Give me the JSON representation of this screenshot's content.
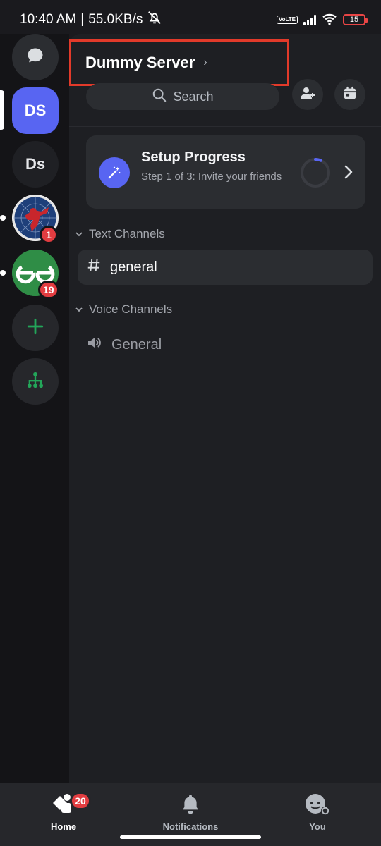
{
  "status_bar": {
    "time": "10:40 AM",
    "speed": "55.0KB/s",
    "network_badge": "VoLTE",
    "battery": "15"
  },
  "server_rail": {
    "direct_messages_icon": "chat-bubble-icon",
    "servers": [
      {
        "label": "DS",
        "selected": true
      },
      {
        "label": "Ds"
      },
      {
        "icon": "spiderman-server-image",
        "badge": "1"
      },
      {
        "icon": "geeksforgeeks-server-image",
        "badge": "19"
      }
    ],
    "add_server_icon": "plus-icon",
    "discover_icon": "hierarchy-icon"
  },
  "server": {
    "name": "Dummy Server",
    "chevron": "›",
    "search_label": "Search"
  },
  "setup": {
    "title": "Setup Progress",
    "subtitle": "Step 1 of 3: Invite your friends",
    "progress": 0.333
  },
  "channels": {
    "text_section": "Text Channels",
    "voice_section": "Voice Channels",
    "text_channel": "general",
    "voice_channel": "General"
  },
  "bottom_nav": {
    "home": "Home",
    "home_badge": "20",
    "notifications": "Notifications",
    "you": "You"
  },
  "colors": {
    "accent": "#5865f2",
    "highlight_box": "#e23a2a",
    "badge": "#e23c40",
    "gfg_green": "#2f8d46"
  }
}
